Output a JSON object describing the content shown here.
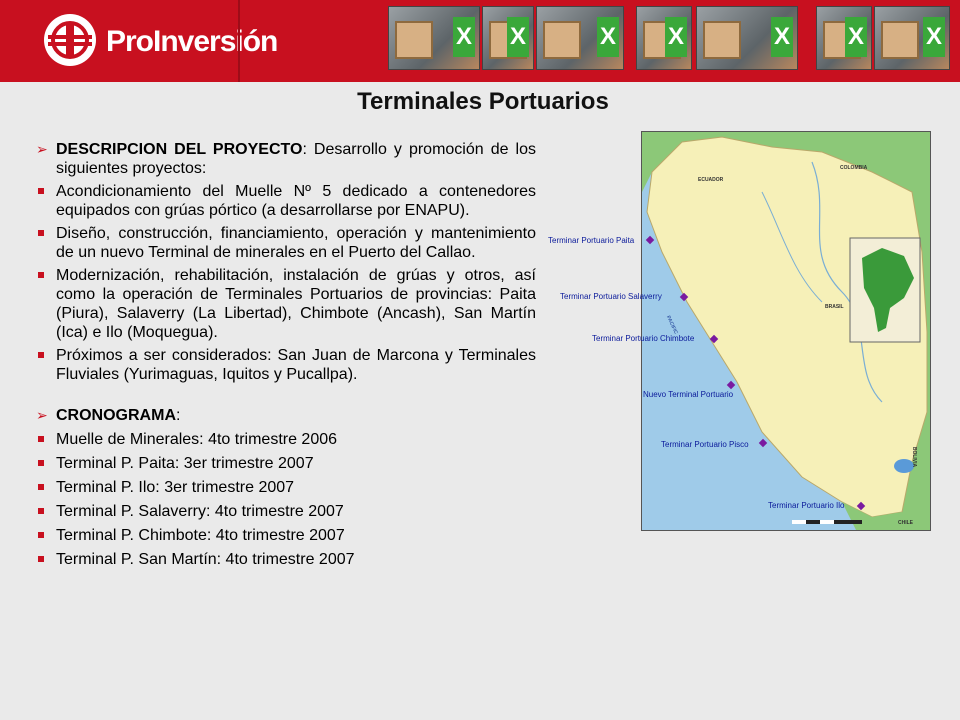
{
  "header": {
    "logo_text": "ProInversión",
    "thumbnails": [
      "excel-thumb",
      "excel-thumb",
      "excel-thumb",
      "excel-thumb",
      "excel-thumb",
      "excel-thumb",
      "excel-thumb",
      "excel-thumb"
    ]
  },
  "title": "Terminales Portuarios",
  "description": {
    "heading": "DESCRIPCION DEL PROYECTO",
    "heading_suffix": ": Desarrollo y promoción de los siguientes proyectos:",
    "items": [
      "Acondicionamiento del Muelle Nº 5 dedicado a contenedores equipados con grúas pórtico (a desarrollarse por ENAPU).",
      "Diseño, construcción, financiamiento, operación y mantenimiento de un nuevo Terminal de minerales en el Puerto del Callao.",
      "Modernización, rehabilitación, instalación de grúas y otros, así como la operación de Terminales Portuarios de provincias: Paita (Piura), Salaverry (La Libertad), Chimbote (Ancash), San Martín (Ica) e Ilo (Moquegua).",
      "Próximos a ser considerados: San Juan de Marcona y Terminales Fluviales (Yurimaguas, Iquitos y Pucallpa)."
    ]
  },
  "schedule": {
    "heading": "CRONOGRAMA",
    "heading_suffix": ":",
    "items": [
      "Muelle de Minerales: 4to trimestre 2006",
      "Terminal P. Paita: 3er trimestre 2007",
      "Terminal P. Ilo: 3er trimestre 2007",
      "Terminal P. Salaverry: 4to trimestre 2007",
      "Terminal P. Chimbote: 4to trimestre 2007",
      "Terminal P. San Martín: 4to trimestre 2007"
    ]
  },
  "map": {
    "ports": [
      {
        "label": "Terminar Portuario Paita"
      },
      {
        "label": "Terminar Portuario Salaverry"
      },
      {
        "label": "Terminar Portuario Chimbote"
      },
      {
        "label": "Nuevo Terminal Portuario"
      },
      {
        "label": "Terminar Portuario Pisco"
      },
      {
        "label": "Terminar Portuario Ilo"
      }
    ],
    "countries": [
      "ECUADOR",
      "COLOMBIA",
      "BRASIL",
      "BOLIVIA",
      "CHILE"
    ],
    "ocean_label": "PACIFIC",
    "colors": {
      "ocean": "#9fcbe9",
      "peru": "#f6f0b8",
      "neighbors": "#8cc878",
      "marker": "#7a1aa0",
      "label": "#0a1a9a"
    }
  }
}
